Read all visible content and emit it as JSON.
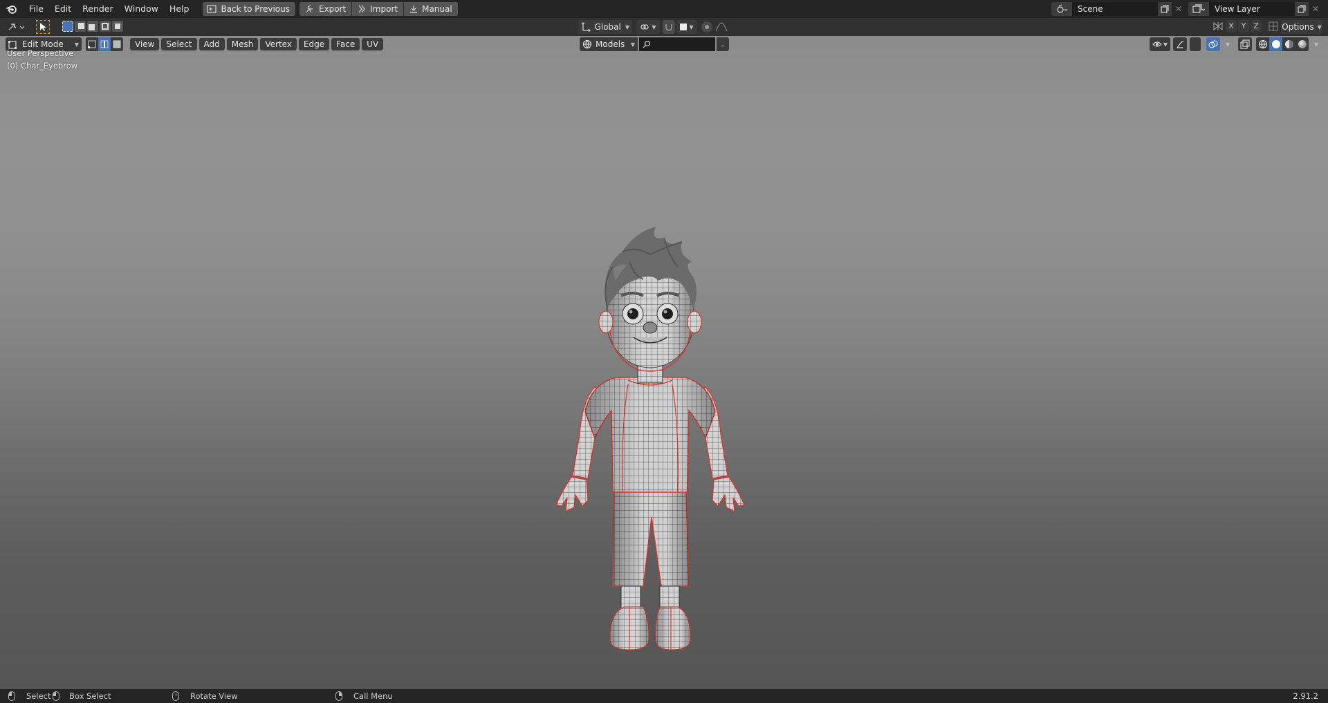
{
  "menubar": {
    "items": [
      "File",
      "Edit",
      "Render",
      "Window",
      "Help"
    ],
    "back_to_previous": "Back to Previous",
    "export": "Export",
    "import": "Import",
    "manual": "Manual"
  },
  "scene": {
    "name": "Scene"
  },
  "view_layer": {
    "name": "View Layer"
  },
  "header": {
    "transform_orientation": "Global",
    "options": "Options",
    "axis": [
      "X",
      "Y",
      "Z"
    ]
  },
  "editor_header": {
    "mode": "Edit Mode",
    "menus": [
      "View",
      "Select",
      "Add",
      "Mesh",
      "Vertex",
      "Edge",
      "Face",
      "UV"
    ],
    "collection_filter": "Models",
    "search_placeholder": ""
  },
  "viewport": {
    "perspective": "User Perspective",
    "active_object": "(0) Char_Eyebrow"
  },
  "statusbar": {
    "select": "Select",
    "box_select": "Box Select",
    "rotate_view": "Rotate View",
    "call_menu": "Call Menu",
    "version": "2.91.2"
  },
  "colors": {
    "accent": "#4772b3",
    "seam": "#d9342b"
  }
}
